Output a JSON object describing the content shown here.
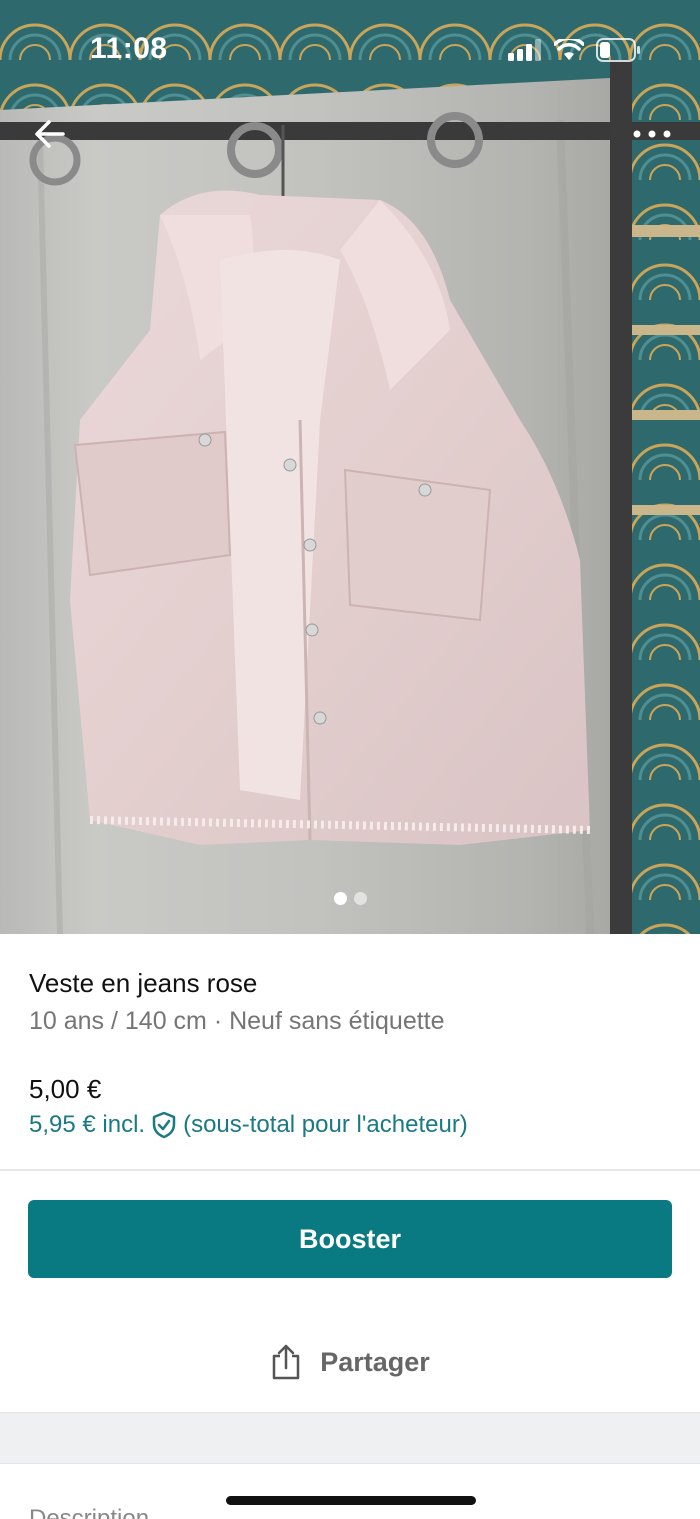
{
  "status_bar": {
    "time": "11:08"
  },
  "gallery": {
    "image_alt": "pink denim jacket photo",
    "page_count": 2,
    "active_page": 1
  },
  "item": {
    "title": "Veste en jeans rose",
    "subtitle": "10 ans / 140 cm · Neuf sans étiquette",
    "price": "5,00 €",
    "price_incl": "5,95 € incl.",
    "price_incl_note": "(sous-total pour l'acheteur)"
  },
  "actions": {
    "booster_label": "Booster",
    "share_label": "Partager"
  },
  "description": {
    "label": "Description"
  },
  "colors": {
    "accent": "#0a7a82",
    "link": "#1a7a83"
  }
}
